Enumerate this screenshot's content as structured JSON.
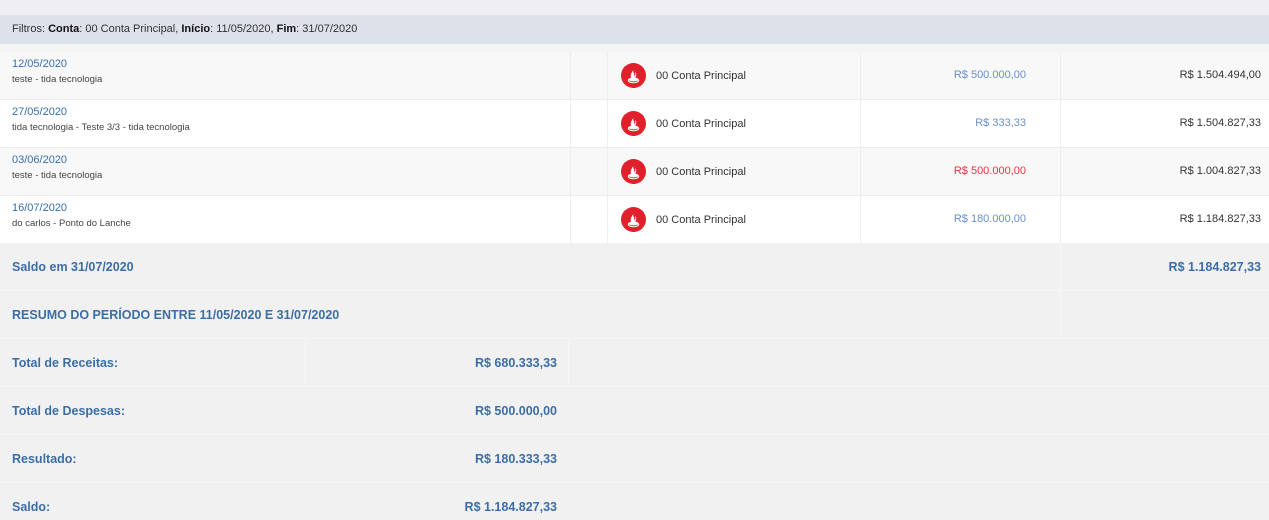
{
  "filters": {
    "prefix": "Filtros:",
    "conta_label": "Conta",
    "conta_value": "00 Conta Principal",
    "inicio_label": "Início",
    "inicio_value": "11/05/2020",
    "fim_label": "Fim",
    "fim_value": "31/07/2020"
  },
  "transactions": [
    {
      "date": "12/05/2020",
      "description": "teste - tida tecnologia",
      "bank_icon": "santander-flame-icon",
      "account": "00 Conta Principal",
      "amount": "R$ 500.000,00",
      "amount_type": "credit",
      "balance": "R$ 1.504.494,00"
    },
    {
      "date": "27/05/2020",
      "description": "tida tecnologia - Teste 3/3 - tida tecnologia",
      "bank_icon": "santander-flame-icon",
      "account": "00 Conta Principal",
      "amount": "R$ 333,33",
      "amount_type": "credit",
      "balance": "R$ 1.504.827,33"
    },
    {
      "date": "03/06/2020",
      "description": "teste - tida tecnologia",
      "bank_icon": "santander-flame-icon",
      "account": "00 Conta Principal",
      "amount": "R$ 500.000,00",
      "amount_type": "debit",
      "balance": "R$ 1.004.827,33"
    },
    {
      "date": "16/07/2020",
      "description": "do carlos - Ponto do Lanche",
      "bank_icon": "santander-flame-icon",
      "account": "00 Conta Principal",
      "amount": "R$ 180.000,00",
      "amount_type": "credit",
      "balance": "R$ 1.184.827,33"
    }
  ],
  "saldo_final": {
    "label": "Saldo em 31/07/2020",
    "value": "R$ 1.184.827,33"
  },
  "resumo": {
    "title": "RESUMO DO PERÍODO ENTRE 11/05/2020 E 31/07/2020",
    "items": [
      {
        "label": "Total de Receitas:",
        "value": "R$ 680.333,33"
      },
      {
        "label": "Total de Despesas:",
        "value": "R$ 500.000,00"
      },
      {
        "label": "Resultado:",
        "value": "R$ 180.333,33"
      },
      {
        "label": "Saldo:",
        "value": "R$ 1.184.827,33"
      }
    ]
  },
  "colors": {
    "accent_blue": "#3b6ea8",
    "credit_blue": "#6a8fc9",
    "debit_red": "#e53541",
    "bank_red": "#e0202a",
    "filter_bar_bg": "#dde1ea"
  }
}
